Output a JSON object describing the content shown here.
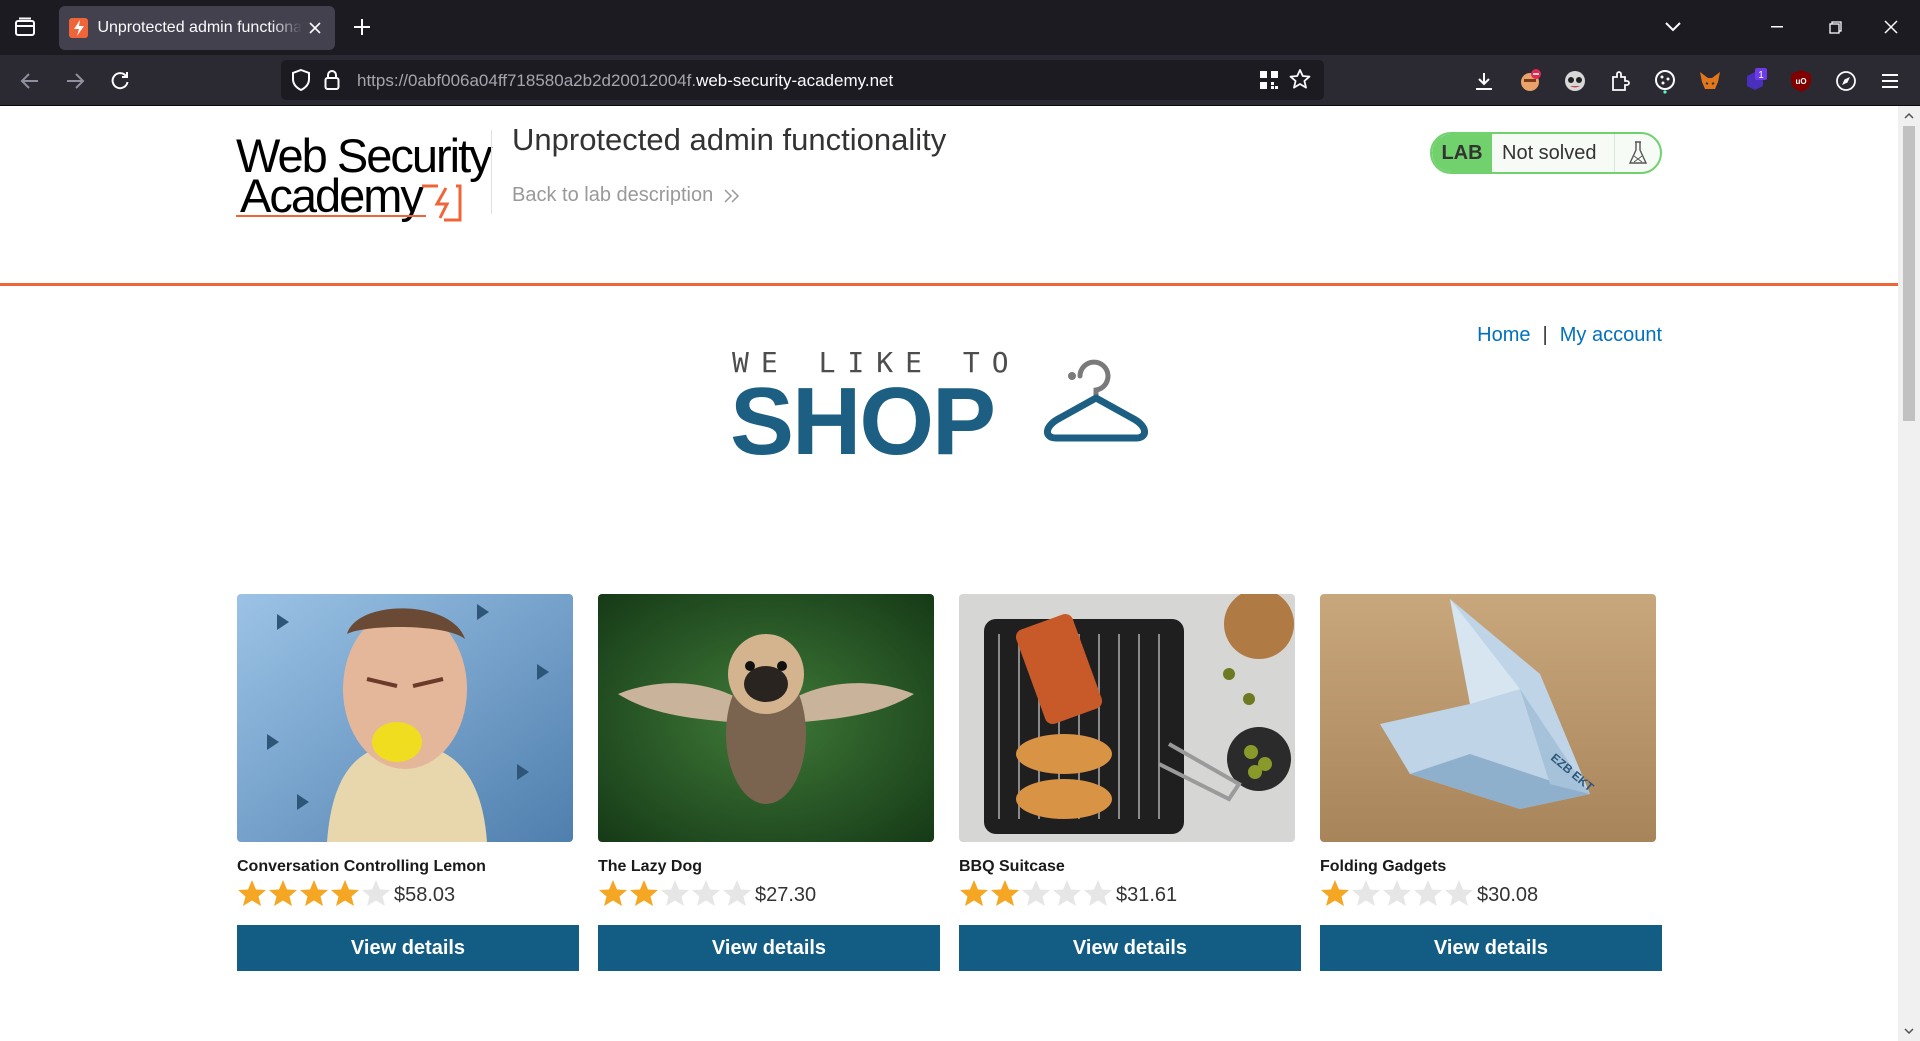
{
  "browser": {
    "tab_title": "Unprotected admin functionality",
    "url_scheme_prefix": "https://0abf006a04ff718580a2b2d20012004f.",
    "url_host": "web-security-academy.net",
    "extension_badge_count": "1"
  },
  "header": {
    "logo_line1": "Web Security",
    "logo_line2": "Academy",
    "lab_title": "Unprotected admin functionality",
    "back_link": "Back to lab description",
    "lab_badge": "LAB",
    "lab_status": "Not solved",
    "accent_color": "#f0643a"
  },
  "nav": {
    "home": "Home",
    "separator": "|",
    "my_account": "My account"
  },
  "banner": {
    "tagline": "WE LIKE TO",
    "shop": "SHOP"
  },
  "products": [
    {
      "name": "Conversation Controlling Lemon",
      "rating": 4,
      "price": "$58.03",
      "button": "View details"
    },
    {
      "name": "The Lazy Dog",
      "rating": 2,
      "price": "$27.30",
      "button": "View details"
    },
    {
      "name": "BBQ Suitcase",
      "rating": 2,
      "price": "$31.61",
      "button": "View details"
    },
    {
      "name": "Folding Gadgets",
      "rating": 1,
      "price": "$30.08",
      "button": "View details"
    }
  ],
  "colors": {
    "button_bg": "#135d84",
    "link": "#0071bc",
    "star_filled": "#f5a623",
    "star_empty": "#e6e6e6",
    "lab_green": "#70d16d"
  }
}
